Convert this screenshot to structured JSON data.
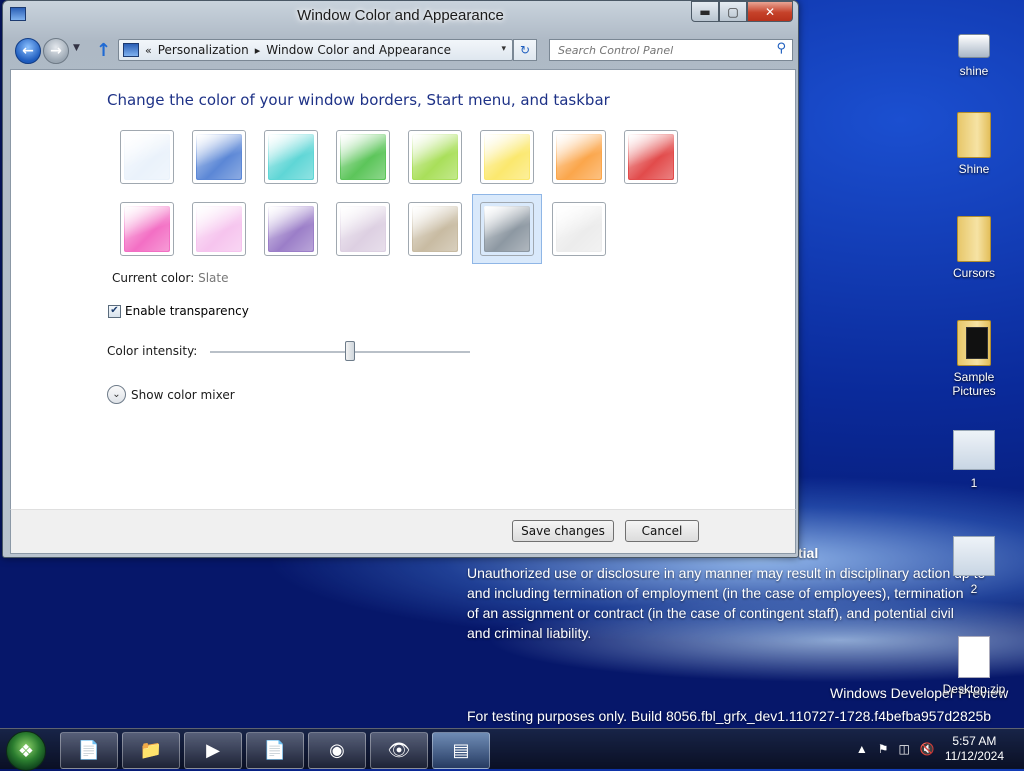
{
  "window": {
    "title": "Window Color and Appearance",
    "caption": {
      "minimize": "▬",
      "maximize": "▢",
      "close": "✕"
    }
  },
  "address_bar": {
    "prefix": "«",
    "crumbs": [
      "Personalization",
      "Window Color and Appearance"
    ],
    "separator": "▸",
    "dropdown": "▾"
  },
  "search": {
    "placeholder": "Search Control Panel"
  },
  "main": {
    "heading": "Change the color of your window borders, Start menu, and taskbar",
    "swatches_row1": [
      "#eaf2fb",
      "#5b87d6",
      "#5fd6d6",
      "#5cc55a",
      "#a9df5a",
      "#fbe86e",
      "#fba64b",
      "#e24b4b"
    ],
    "swatches_row2": [
      "#f36fc4",
      "#f6c4ee",
      "#9b7ec8",
      "#ddd0e2",
      "#c8bba2",
      "#8d98a2",
      "#ececec"
    ],
    "current_color_label": "Current color:",
    "current_color_value": "Slate",
    "enable_transparency_label": "Enable transparency",
    "enable_transparency_checked": true,
    "intensity_label": "Color intensity:",
    "intensity_level": 0.54,
    "mixer_label": "Show color mixer"
  },
  "buttons": {
    "save": "Save changes",
    "cancel": "Cancel"
  },
  "desktop": {
    "icons": [
      "shine",
      "Shine",
      "Cursors",
      "Sample Pictures",
      "1",
      "2",
      "Desktop.zip"
    ],
    "notice_title": "tial",
    "notice_lines": [
      "Unauthorized use or disclosure in any manner may result in disciplinary action up to",
      "and including termination of employment (in the case of employees), termination",
      "of an assignment or contract (in the case of contingent staff), and potential civil",
      "and criminal liability."
    ],
    "watermark_title": "Windows Developer Preview",
    "watermark_build": "For testing purposes only. Build 8056.fbl_grfx_dev1.110727-1728.f4befba957d2825b"
  },
  "taskbar": {
    "clock_time": "5:57 AM",
    "clock_date": "11/12/2024"
  }
}
